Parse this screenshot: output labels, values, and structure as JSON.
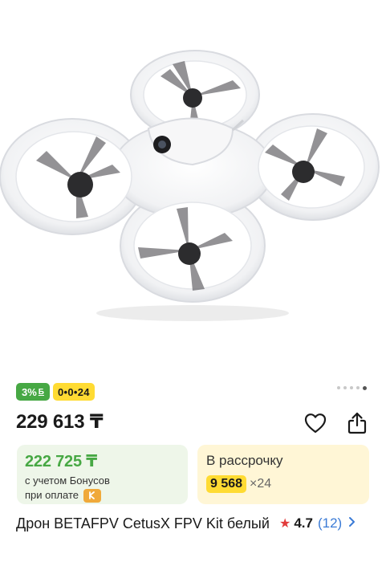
{
  "product": {
    "image_alt": "Дрон BETAFPV CetusX FPV Kit белый",
    "carousel": {
      "total": 5,
      "active_index": 4
    },
    "badges": {
      "bonus_label": "3%",
      "bonus_icon": "Б",
      "installment_label": "0•0•24"
    },
    "price": "229 613 ₸",
    "actions": {
      "favorite_icon": "heart-outline",
      "share_icon": "share-upload"
    },
    "bonus_card": {
      "price": "222 725 ₸",
      "line1": "с учетом Бонусов",
      "line2": "при оплате",
      "accent": "#47a844"
    },
    "installment_card": {
      "title": "В рассрочку",
      "amount": "9 568",
      "months": "×24"
    },
    "title": "Дрон BETAFPV CetusX FPV Kit белый",
    "rating": {
      "value": "4.7",
      "count": "(12)"
    }
  }
}
